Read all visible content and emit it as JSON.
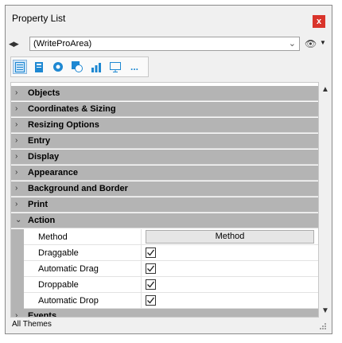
{
  "window": {
    "title": "Property List",
    "close_label": "x"
  },
  "target": {
    "value": "(WriteProArea)"
  },
  "toolbar": {
    "icons": [
      "list-icon",
      "form-icon",
      "settings-icon",
      "object-icon",
      "chart-icon",
      "monitor-icon",
      "more-icon"
    ],
    "more_label": "..."
  },
  "categories": [
    {
      "label": "Objects",
      "expanded": false
    },
    {
      "label": "Coordinates & Sizing",
      "expanded": false
    },
    {
      "label": "Resizing Options",
      "expanded": false
    },
    {
      "label": "Entry",
      "expanded": false
    },
    {
      "label": "Display",
      "expanded": false
    },
    {
      "label": "Appearance",
      "expanded": false
    },
    {
      "label": "Background and Border",
      "expanded": false
    },
    {
      "label": "Print",
      "expanded": false
    },
    {
      "label": "Action",
      "expanded": true
    },
    {
      "label": "Events",
      "expanded": false
    }
  ],
  "action_props": [
    {
      "name": "Method",
      "type": "button",
      "value": "Method"
    },
    {
      "name": "Draggable",
      "type": "checkbox",
      "checked": true
    },
    {
      "name": "Automatic Drag",
      "type": "checkbox",
      "checked": true
    },
    {
      "name": "Droppable",
      "type": "checkbox",
      "checked": true
    },
    {
      "name": "Automatic Drop",
      "type": "checkbox",
      "checked": true
    }
  ],
  "status": {
    "text": "All Themes"
  },
  "colors": {
    "category_bg": "#b4b4b4",
    "close_bg": "#d9342b",
    "icon_blue": "#1e88d2"
  }
}
